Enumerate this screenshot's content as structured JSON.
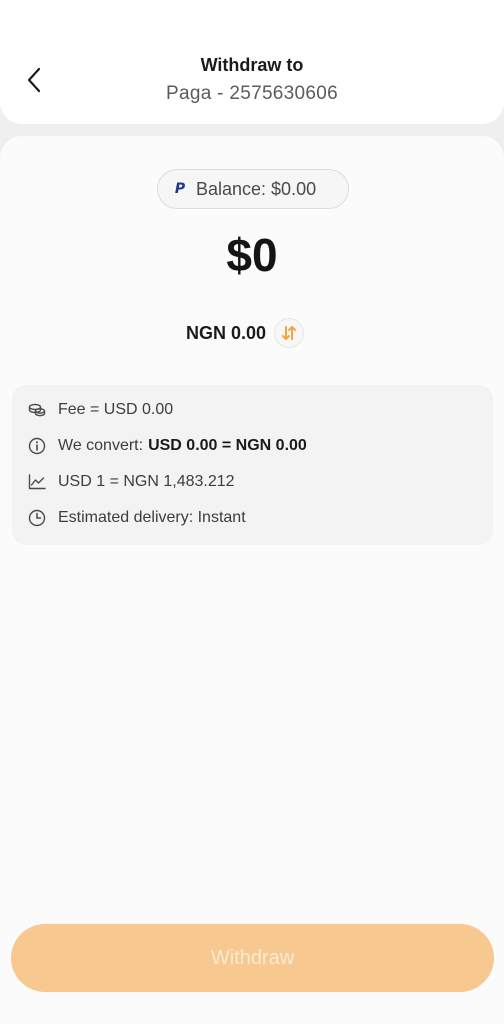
{
  "header": {
    "title": "Withdraw to",
    "subtitle": "Paga - 2575630606"
  },
  "balance": {
    "label": "Balance: $0.00",
    "icon": "paypal-icon"
  },
  "amount": {
    "value": "$0",
    "converted": "NGN 0.00"
  },
  "info": {
    "fee": "Fee = USD 0.00",
    "convert_label": "We convert:",
    "convert_value": "USD 0.00 = NGN 0.00",
    "rate": "USD 1 = NGN 1,483.212",
    "delivery": "Estimated delivery: Instant"
  },
  "actions": {
    "withdraw_label": "Withdraw"
  },
  "colors": {
    "accent": "#f7a440",
    "button_disabled": "#f7c990"
  }
}
